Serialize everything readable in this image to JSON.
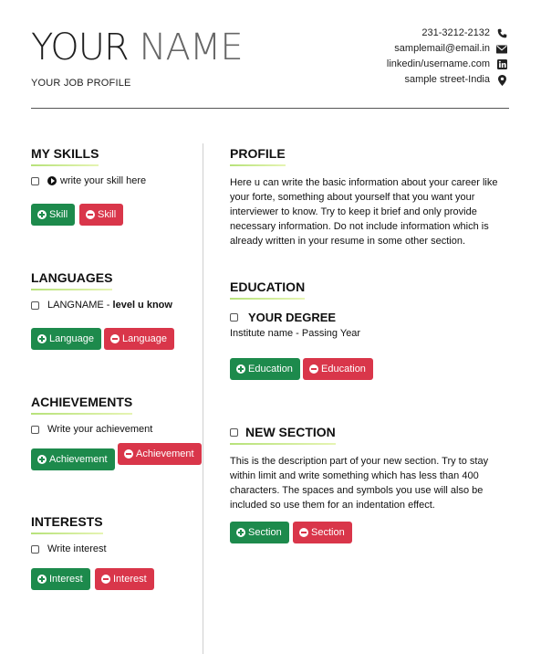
{
  "header": {
    "first_name": "YOUR",
    "last_name": "NAME",
    "job_profile": "YOUR JOB PROFILE",
    "contacts": [
      {
        "text": "231-3212-2132",
        "icon": "phone-icon"
      },
      {
        "text": "samplemail@email.in",
        "icon": "envelope-icon"
      },
      {
        "text": "linkedin/username.com",
        "icon": "linkedin-icon"
      },
      {
        "text": "sample street-India",
        "icon": "map-marker-icon"
      }
    ]
  },
  "left": {
    "skills": {
      "title": "MY SKILLS",
      "item": "write your skill here",
      "add": "Skill",
      "remove": "Skill"
    },
    "languages": {
      "title": "LANGUAGES",
      "item_name": "LANGNAME",
      "item_sep": " - ",
      "item_level": "level u know",
      "add": "Language",
      "remove": "Language"
    },
    "achievements": {
      "title": "ACHIEVEMENTS",
      "item": "Write your achievement",
      "add": "Achievement",
      "remove": "Achievement"
    },
    "interests": {
      "title": "INTERESTS",
      "item": "Write interest",
      "add": "Interest",
      "remove": "Interest"
    }
  },
  "right": {
    "profile": {
      "title": "PROFILE",
      "text": "Here u can write the basic information about your career like your forte, something about yourself that you want your interviewer to know. Try to keep it brief and only provide necessary information. Do not include information which is already written in your resume in some other section."
    },
    "education": {
      "title": "EDUCATION",
      "degree": "YOUR DEGREE",
      "institute": "Institute name - Passing Year",
      "add": "Education",
      "remove": "Education"
    },
    "new_section": {
      "title": "NEW SECTION",
      "text": "This is the description part of your new section. Try to stay within limit and write something which has less than 400 characters. The spaces and symbols you use will also be included so use them for an indentation effect.",
      "add": "Section",
      "remove": "Section"
    }
  },
  "colors": {
    "add_button": "#1d8a4c",
    "remove_button": "#d9364a",
    "title_underline": "#b7e27a"
  }
}
